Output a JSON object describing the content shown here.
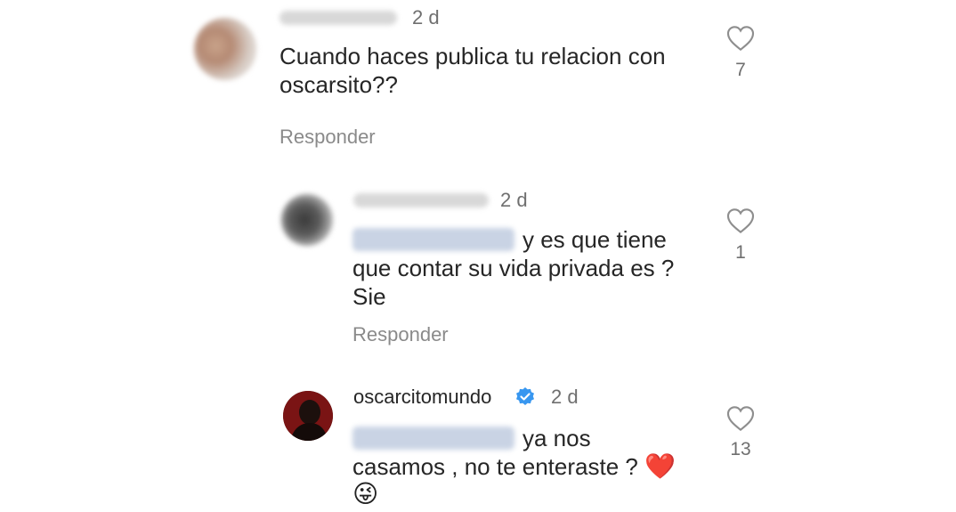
{
  "comments": [
    {
      "username": "",
      "time": "2 d",
      "text_line1": "Cuando haces publica tu relacion con",
      "text_line2": "oscarsito??",
      "likes": "7",
      "reply_label": "Responder"
    },
    {
      "username": "",
      "time": "2 d",
      "mention": "",
      "text_line1": "y es que tiene",
      "text_line2": "que contar su vida privada es ?",
      "text_line3": "Sie",
      "likes": "1",
      "reply_label": "Responder"
    },
    {
      "username": "oscarcitomundo",
      "time": "2 d",
      "mention": "",
      "text_line1": "ya nos",
      "text_line2": "casamos , no te enteraste ?",
      "emoji_heart": "❤️",
      "emoji_face": "😜",
      "likes": "13"
    }
  ],
  "colors": {
    "verified_blue": "#3897f0",
    "heart_red": "#e0242f"
  },
  "icons": [
    "heart-outline-icon",
    "verified-badge-icon"
  ]
}
